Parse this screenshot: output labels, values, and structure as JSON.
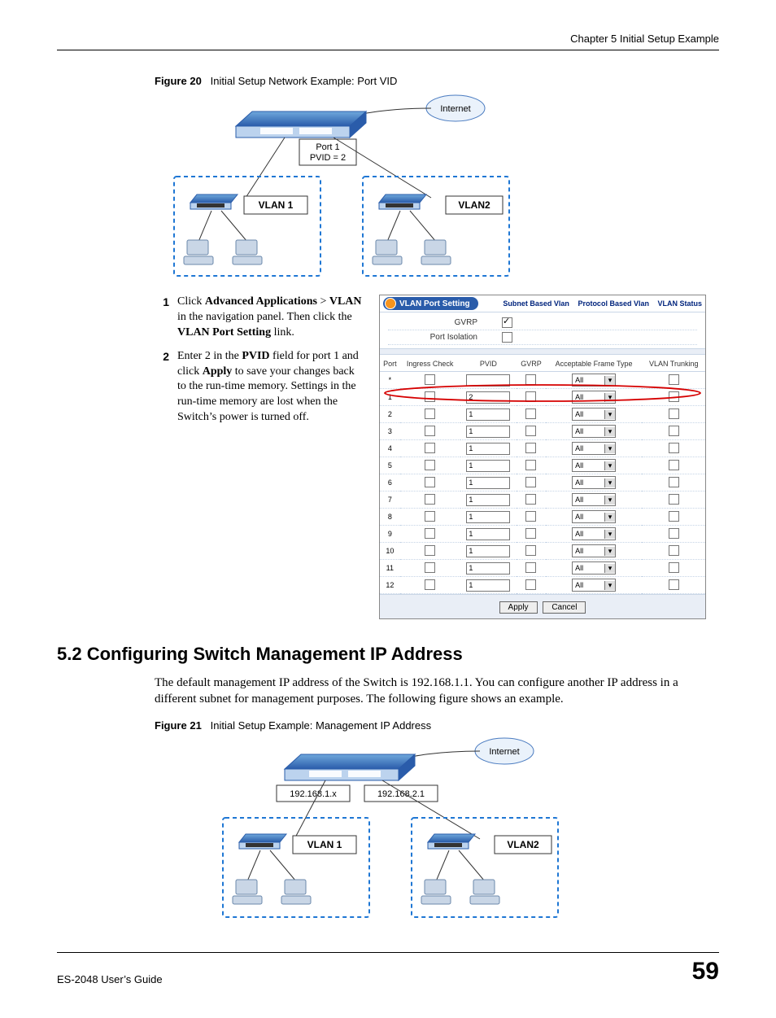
{
  "header": {
    "chapter": "Chapter 5 Initial Setup Example"
  },
  "figure20": {
    "caption_label": "Figure 20",
    "caption_text": "Initial Setup Network Example: Port VID",
    "labels": {
      "internet": "Internet",
      "port1": "Port 1",
      "pvid": "PVID = 2",
      "vlan1": "VLAN 1",
      "vlan2": "VLAN2"
    }
  },
  "steps": {
    "s1": {
      "num": "1",
      "pre": "Click ",
      "b1": "Advanced Applications",
      "sep": " > ",
      "b2": "VLAN",
      "mid": " in the navigation panel. Then click the ",
      "b3": "VLAN Port Setting",
      "post": " link."
    },
    "s2": {
      "num": "2",
      "pre": "Enter 2 in the ",
      "b1": "PVID",
      "mid": " field for port 1 and click ",
      "b2": "Apply",
      "post": " to save your changes back to the run-time memory. Settings in the run-time memory are lost when the Switch’s power is turned off."
    }
  },
  "ui": {
    "title": "VLAN Port Setting",
    "links": {
      "subnet": "Subnet Based Vlan",
      "protocol": "Protocol Based Vlan",
      "status": "VLAN Status"
    },
    "opts": {
      "gvrp": "GVRP",
      "port_isolation": "Port Isolation"
    },
    "cols": {
      "port": "Port",
      "ingress": "Ingress Check",
      "pvid": "PVID",
      "gvrp": "GVRP",
      "aft": "Acceptable Frame Type",
      "trunk": "VLAN Trunking"
    },
    "rows": [
      {
        "port": "*",
        "pvid": "",
        "aft": "All"
      },
      {
        "port": "1",
        "pvid": "2",
        "aft": "All"
      },
      {
        "port": "2",
        "pvid": "1",
        "aft": "All"
      },
      {
        "port": "3",
        "pvid": "1",
        "aft": "All"
      },
      {
        "port": "4",
        "pvid": "1",
        "aft": "All"
      },
      {
        "port": "5",
        "pvid": "1",
        "aft": "All"
      },
      {
        "port": "6",
        "pvid": "1",
        "aft": "All"
      },
      {
        "port": "7",
        "pvid": "1",
        "aft": "All"
      },
      {
        "port": "8",
        "pvid": "1",
        "aft": "All"
      },
      {
        "port": "9",
        "pvid": "1",
        "aft": "All"
      },
      {
        "port": "10",
        "pvid": "1",
        "aft": "All"
      },
      {
        "port": "11",
        "pvid": "1",
        "aft": "All"
      },
      {
        "port": "12",
        "pvid": "1",
        "aft": "All"
      }
    ],
    "buttons": {
      "apply": "Apply",
      "cancel": "Cancel"
    }
  },
  "section52": {
    "heading": "5.2  Configuring Switch Management IP Address",
    "body": "The default management IP address of the Switch is 192.168.1.1. You can configure another IP address in a different subnet for management purposes. The following figure shows an example."
  },
  "figure21": {
    "caption_label": "Figure 21",
    "caption_text": "Initial Setup Example: Management IP Address",
    "labels": {
      "internet": "Internet",
      "ipa": "192.168.1.x",
      "ipb": "192.168.2.1",
      "vlan1": "VLAN 1",
      "vlan2": "VLAN2"
    }
  },
  "footer": {
    "guide": "ES-2048 User’s Guide",
    "page": "59"
  }
}
